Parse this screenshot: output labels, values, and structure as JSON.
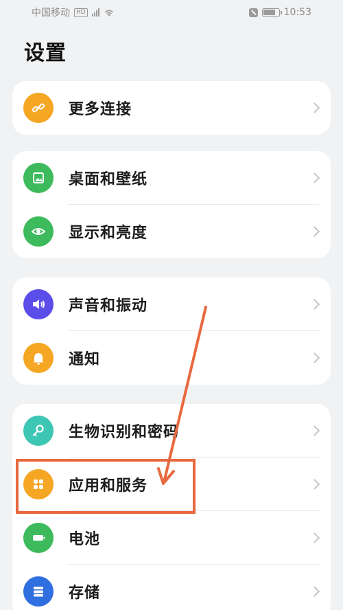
{
  "status_bar": {
    "carrier": "中国移动",
    "network_badge": "HD",
    "time": "10:53",
    "icons": [
      "signal-icon",
      "wifi-icon",
      "mute-icon",
      "battery-icon"
    ]
  },
  "page_title": "设置",
  "groups": [
    {
      "items": [
        {
          "label": "更多连接",
          "icon": "link-icon",
          "color": "#f5a623"
        }
      ]
    },
    {
      "items": [
        {
          "label": "桌面和壁纸",
          "icon": "wallpaper-icon",
          "color": "#3dbb5c"
        },
        {
          "label": "显示和亮度",
          "icon": "eye-icon",
          "color": "#3dbb5c"
        }
      ]
    },
    {
      "items": [
        {
          "label": "声音和振动",
          "icon": "speaker-icon",
          "color": "#5b4ee8"
        },
        {
          "label": "通知",
          "icon": "bell-icon",
          "color": "#f5a623"
        }
      ]
    },
    {
      "items": [
        {
          "label": "生物识别和密码",
          "icon": "key-icon",
          "color": "#3ec6b4"
        },
        {
          "label": "应用和服务",
          "icon": "apps-icon",
          "color": "#f5a623"
        },
        {
          "label": "电池",
          "icon": "battery-settings-icon",
          "color": "#3dbb5c"
        },
        {
          "label": "存储",
          "icon": "storage-icon",
          "color": "#2f6fe0"
        }
      ]
    }
  ],
  "annotation": {
    "highlighted_item": "应用和服务",
    "color": "#e8693f"
  }
}
